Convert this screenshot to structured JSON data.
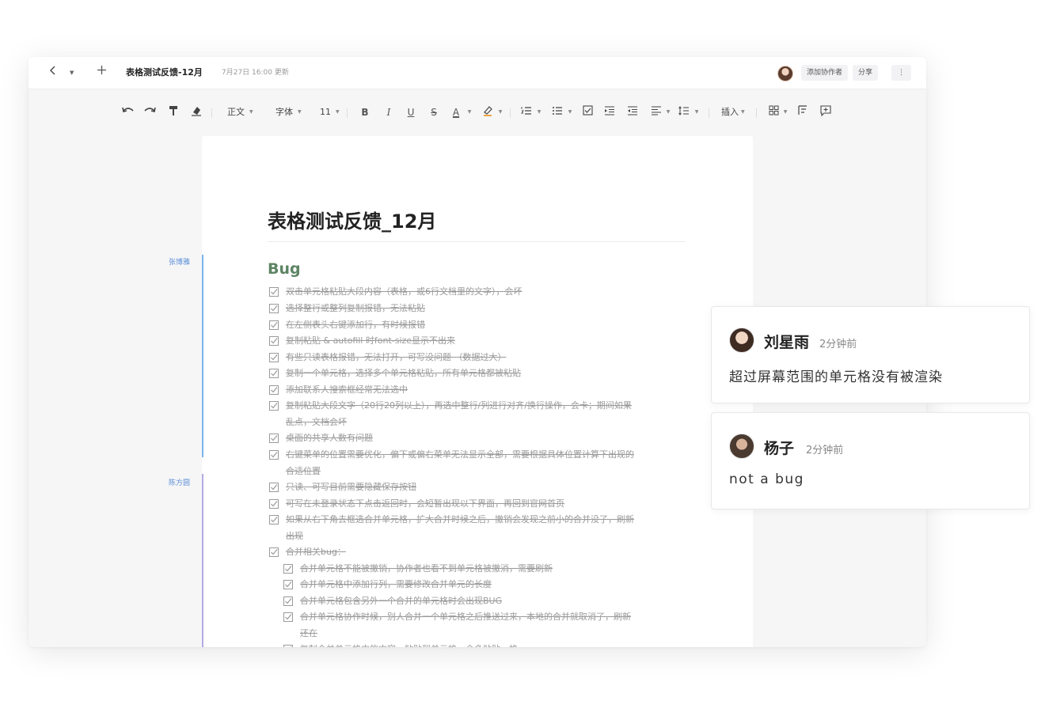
{
  "window": {
    "title": "表格测试反馈-12月",
    "updated": "7月27日 16:00 更新",
    "add_collaborator": "添加协作者",
    "share": "分享"
  },
  "toolbar": {
    "paragraph": "正文",
    "font": "字体",
    "size": "11",
    "bold": "B",
    "italic": "I",
    "underline": "U",
    "strike": "S",
    "font_color": "A",
    "insert": "插入"
  },
  "document": {
    "title": "表格测试反馈_12月",
    "section": "Bug",
    "authors": [
      "张博雅",
      "陈方圆"
    ],
    "items": [
      {
        "text": "双击单元格粘贴大段内容（表格，或6行文档里的文字），会坏"
      },
      {
        "text": "选择整行或整列复制报错，无法粘贴"
      },
      {
        "text": "在左侧表头右键添加行，有时候报错"
      },
      {
        "text": "复制粘贴 & autofill 时font-size显示不出来"
      },
      {
        "text": "有些只读表格报错，无法打开，可写没问题 （数据过大）"
      },
      {
        "text": "复制一个单元格，选择多个单元格粘贴，所有单元格都被粘贴"
      },
      {
        "text": "添加联系人搜索框经常无法选中"
      },
      {
        "text": "复制粘贴大段文字（20行20列以上），再选中整行/列进行对齐/换行操作，会卡；期间如果",
        "text2": "乱点，文档会坏"
      },
      {
        "text": "桌面的共享人数有问题"
      },
      {
        "text": "右键菜单的位置需要优化，偏下或偏右菜单无法显示全部，需要根据具体位置计算下出现的",
        "text2": "合适位置"
      },
      {
        "text": "只读、可写目前需要隐藏保存按钮"
      },
      {
        "text": "可写在未登录状态下点击返回时，会短暂出现以下界面，再回到官网首页"
      },
      {
        "text": "如果从右下角去框选合并单元格，扩大合并时候之后，撤销会发现之前小的合并没了，刷新",
        "text2": "出现"
      },
      {
        "text": "合并相关bug："
      },
      {
        "text": "合并单元格不能被撤销，协作者也看不到单元格被撤消，需要刷新"
      },
      {
        "text": "合并单元格中添加行列，需要修改合并单元的长度"
      },
      {
        "text": "合并单元格包含另外一个合并的单元格时会出现BUG"
      },
      {
        "text": "合并单元格协作时候，别人合并一个单元格之后推送过来，本地的合并就取消了，刷新",
        "text2": "还在"
      },
      {
        "text": "复制合并单元格中的内容，粘贴到单元格，会多粘贴一格"
      }
    ]
  },
  "comments": [
    {
      "name": "刘星雨",
      "time": "2分钟前",
      "body": "超过屏幕范围的单元格没有被渲染"
    },
    {
      "name": "杨子",
      "time": "2分钟前",
      "body": "not a bug"
    }
  ],
  "colors": {
    "section_green": "#5d8463",
    "author_blue": "#5b8ed6",
    "author_bar_blue": "#7fb2ec",
    "author_bar_purple": "#b3aae3"
  }
}
